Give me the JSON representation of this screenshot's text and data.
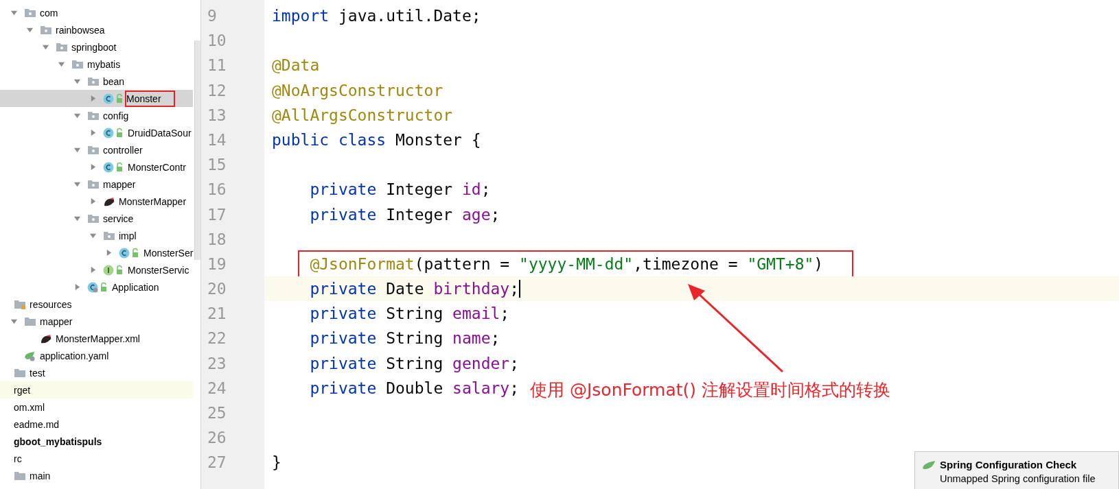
{
  "project_tree": [
    {
      "label": "com",
      "kind": "package",
      "expanded": true,
      "selected": false,
      "highlighted": false,
      "children": [
        {
          "label": "rainbowsea",
          "kind": "package",
          "expanded": true,
          "selected": false,
          "highlighted": false,
          "children": [
            {
              "label": "springboot",
              "kind": "package",
              "expanded": true,
              "selected": false,
              "highlighted": false,
              "children": [
                {
                  "label": "mybatis",
                  "kind": "package",
                  "expanded": true,
                  "selected": false,
                  "highlighted": false,
                  "children": [
                    {
                      "label": "bean",
                      "kind": "package",
                      "expanded": true,
                      "selected": false,
                      "highlighted": false,
                      "children": [
                        {
                          "label": "Monster",
                          "kind": "class",
                          "expanded": false,
                          "selected": true,
                          "highlighted": false,
                          "marked": true
                        }
                      ]
                    },
                    {
                      "label": "config",
                      "kind": "package",
                      "expanded": true,
                      "selected": false,
                      "highlighted": false,
                      "children": [
                        {
                          "label": "DruidDataSour",
                          "kind": "class",
                          "expanded": false,
                          "selected": false,
                          "highlighted": false
                        }
                      ]
                    },
                    {
                      "label": "controller",
                      "kind": "package",
                      "expanded": true,
                      "selected": false,
                      "highlighted": false,
                      "children": [
                        {
                          "label": "MonsterContr",
                          "kind": "class",
                          "expanded": false,
                          "selected": false,
                          "highlighted": false
                        }
                      ]
                    },
                    {
                      "label": "mapper",
                      "kind": "package",
                      "expanded": true,
                      "selected": false,
                      "highlighted": false,
                      "children": [
                        {
                          "label": "MonsterMapper",
                          "kind": "mapper",
                          "expanded": false,
                          "selected": false,
                          "highlighted": false
                        }
                      ]
                    },
                    {
                      "label": "service",
                      "kind": "package",
                      "expanded": true,
                      "selected": false,
                      "highlighted": false,
                      "children": [
                        {
                          "label": "impl",
                          "kind": "package",
                          "expanded": true,
                          "selected": false,
                          "highlighted": false,
                          "children": [
                            {
                              "label": "MonsterSer",
                              "kind": "class",
                              "expanded": false,
                              "selected": false,
                              "highlighted": false
                            }
                          ]
                        },
                        {
                          "label": "MonsterServic",
                          "kind": "interface",
                          "expanded": false,
                          "selected": false,
                          "highlighted": false
                        }
                      ]
                    },
                    {
                      "label": "Application",
                      "kind": "application",
                      "expanded": false,
                      "selected": false,
                      "highlighted": false
                    }
                  ]
                }
              ]
            }
          ]
        }
      ]
    },
    {
      "label": "resources",
      "kind": "resources-folder",
      "selected": false,
      "highlighted": false,
      "children": [
        {
          "label": "mapper",
          "kind": "folder",
          "expanded": true,
          "selected": false,
          "highlighted": false,
          "children": [
            {
              "label": "MonsterMapper.xml",
              "kind": "mapper",
              "selected": false,
              "highlighted": false
            }
          ]
        },
        {
          "label": "application.yaml",
          "kind": "yaml",
          "selected": false,
          "highlighted": false
        }
      ]
    },
    {
      "label": "test",
      "kind": "source-folder",
      "selected": false,
      "highlighted": false
    },
    {
      "label": "rget",
      "kind": "module-entry",
      "selected": false,
      "highlighted": true
    },
    {
      "label": "om.xml",
      "kind": "module-entry",
      "selected": false,
      "highlighted": false
    },
    {
      "label": "eadme.md",
      "kind": "module-entry",
      "selected": false,
      "highlighted": false
    },
    {
      "label": "gboot_mybatispuls",
      "kind": "module",
      "selected": false,
      "highlighted": false
    },
    {
      "label": "rc",
      "kind": "module-entry",
      "selected": false,
      "highlighted": false
    },
    {
      "label": "main",
      "kind": "source-folder",
      "selected": false,
      "highlighted": false
    }
  ],
  "editor": {
    "lines": [
      {
        "number": "9",
        "current": false,
        "marked": false,
        "tokens": [
          {
            "kind": "keyword",
            "text": "import"
          },
          {
            "kind": "plain",
            "text": " java.util.Date;"
          }
        ]
      },
      {
        "number": "10",
        "current": false,
        "marked": false
      },
      {
        "number": "11",
        "current": false,
        "marked": false,
        "tokens": [
          {
            "kind": "annotation",
            "text": "@Data"
          }
        ]
      },
      {
        "number": "12",
        "current": false,
        "marked": false,
        "tokens": [
          {
            "kind": "annotation",
            "text": "@NoArgsConstructor"
          }
        ]
      },
      {
        "number": "13",
        "current": false,
        "marked": false,
        "tokens": [
          {
            "kind": "annotation",
            "text": "@AllArgsConstructor"
          }
        ]
      },
      {
        "number": "14",
        "current": false,
        "marked": false,
        "tokens": [
          {
            "kind": "keyword",
            "text": "public class"
          },
          {
            "kind": "plain",
            "text": " Monster "
          },
          {
            "kind": "brace",
            "text": "{"
          }
        ]
      },
      {
        "number": "15",
        "current": false,
        "marked": false
      },
      {
        "number": "16",
        "current": false,
        "marked": false,
        "tokens": [
          {
            "kind": "keyword",
            "text": "    private"
          },
          {
            "kind": "plain",
            "text": " Integer "
          },
          {
            "kind": "field",
            "text": "id"
          },
          {
            "kind": "plain",
            "text": ";"
          }
        ]
      },
      {
        "number": "17",
        "current": false,
        "marked": false,
        "tokens": [
          {
            "kind": "keyword",
            "text": "    private"
          },
          {
            "kind": "plain",
            "text": " Integer "
          },
          {
            "kind": "field",
            "text": "age"
          },
          {
            "kind": "plain",
            "text": ";"
          }
        ]
      },
      {
        "number": "18",
        "current": false,
        "marked": false
      },
      {
        "number": "19",
        "current": false,
        "marked": true,
        "tokens": [
          {
            "kind": "annotation",
            "text": "    @JsonFormat"
          },
          {
            "kind": "plain",
            "text": "(pattern = "
          },
          {
            "kind": "string",
            "text": "\"yyyy-MM-dd\""
          },
          {
            "kind": "plain",
            "text": ",timezone = "
          },
          {
            "kind": "string",
            "text": "\"GMT+8\""
          },
          {
            "kind": "plain",
            "text": ")"
          }
        ]
      },
      {
        "number": "20",
        "current": true,
        "marked": false,
        "tokens": [
          {
            "kind": "keyword",
            "text": "    private"
          },
          {
            "kind": "plain",
            "text": " Date "
          },
          {
            "kind": "field",
            "text": "birthday"
          },
          {
            "kind": "plain",
            "text": ";"
          }
        ]
      },
      {
        "number": "21",
        "current": false,
        "marked": false,
        "tokens": [
          {
            "kind": "keyword",
            "text": "    private"
          },
          {
            "kind": "plain",
            "text": " String "
          },
          {
            "kind": "field",
            "text": "email"
          },
          {
            "kind": "plain",
            "text": ";"
          }
        ]
      },
      {
        "number": "22",
        "current": false,
        "marked": false,
        "tokens": [
          {
            "kind": "keyword",
            "text": "    private"
          },
          {
            "kind": "plain",
            "text": " String "
          },
          {
            "kind": "field",
            "text": "name"
          },
          {
            "kind": "plain",
            "text": ";"
          }
        ]
      },
      {
        "number": "23",
        "current": false,
        "marked": false,
        "tokens": [
          {
            "kind": "keyword",
            "text": "    private"
          },
          {
            "kind": "plain",
            "text": " String "
          },
          {
            "kind": "field",
            "text": "gender"
          },
          {
            "kind": "plain",
            "text": ";"
          }
        ]
      },
      {
        "number": "24",
        "current": false,
        "marked": false,
        "tokens": [
          {
            "kind": "keyword",
            "text": "    private"
          },
          {
            "kind": "plain",
            "text": " Double "
          },
          {
            "kind": "field",
            "text": "salary"
          },
          {
            "kind": "plain",
            "text": ";"
          }
        ]
      },
      {
        "number": "25",
        "current": false,
        "marked": false
      },
      {
        "number": "26",
        "current": false,
        "marked": false
      },
      {
        "number": "27",
        "current": false,
        "marked": false,
        "tokens": [
          {
            "kind": "brace",
            "text": "}"
          }
        ]
      }
    ],
    "callout": "使用 @JsonFormat() 注解设置时间格式的转换"
  },
  "notification": {
    "title": "Spring Configuration Check",
    "message": "Unmapped Spring configuration file"
  }
}
